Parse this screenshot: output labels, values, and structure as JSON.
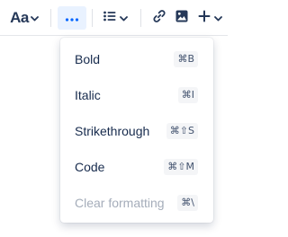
{
  "toolbar": {
    "text_style_label": "Aa",
    "icons": {
      "text_style_chevron": "chevron-down-icon",
      "more": "more-horizontal-icon",
      "list": "bulleted-list-icon",
      "list_chevron": "chevron-down-icon",
      "link": "link-icon",
      "image": "image-icon",
      "insert": "plus-icon",
      "insert_chevron": "chevron-down-icon"
    },
    "active_color": "#0065ff",
    "active_bg": "#e9f2ff"
  },
  "menu": {
    "items": [
      {
        "label": "Bold",
        "shortcut": "⌘B",
        "disabled": false
      },
      {
        "label": "Italic",
        "shortcut": "⌘I",
        "disabled": false
      },
      {
        "label": "Strikethrough",
        "shortcut": "⌘⇧S",
        "disabled": false
      },
      {
        "label": "Code",
        "shortcut": "⌘⇧M",
        "disabled": false
      },
      {
        "label": "Clear formatting",
        "shortcut": "⌘\\",
        "disabled": true
      }
    ]
  }
}
